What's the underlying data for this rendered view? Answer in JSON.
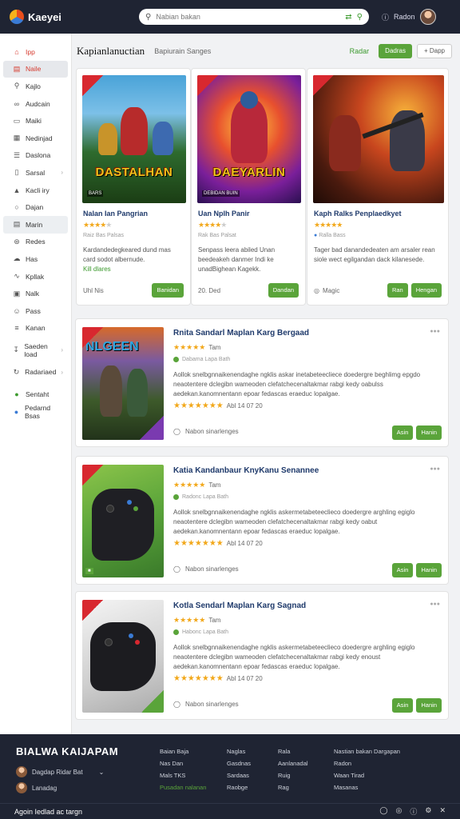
{
  "app": {
    "logo_text": "Kaeyei"
  },
  "search": {
    "placeholder": "Nabian bakan"
  },
  "topbar": {
    "user_label": "Radon"
  },
  "sidebar": {
    "items": [
      {
        "label": "Ipp",
        "icon": "home-icon"
      },
      {
        "label": "Naile",
        "icon": "store-icon"
      },
      {
        "label": "Kajlo",
        "icon": "search-icon"
      },
      {
        "label": "Audcain",
        "icon": "link-icon"
      },
      {
        "label": "Maiki",
        "icon": "monitor-icon"
      },
      {
        "label": "Nedinjad",
        "icon": "grid-icon"
      },
      {
        "label": "Daslona",
        "icon": "list-icon"
      },
      {
        "label": "Sarsal",
        "icon": "doc-icon"
      },
      {
        "label": "Kacli iry",
        "icon": "chart-icon"
      },
      {
        "label": "Dajan",
        "icon": "tag-icon"
      },
      {
        "label": "Marin",
        "icon": "layers-icon"
      },
      {
        "label": "Redes",
        "icon": "cart-icon"
      },
      {
        "label": "Has",
        "icon": "cloud-icon"
      },
      {
        "label": "Kpllak",
        "icon": "pulse-icon"
      },
      {
        "label": "Nalk",
        "icon": "image-icon"
      },
      {
        "label": "Pass",
        "icon": "user-icon"
      },
      {
        "label": "Kanan",
        "icon": "menu-icon"
      },
      {
        "label": "Saeden load",
        "icon": "download-icon"
      },
      {
        "label": "Radariaed",
        "icon": "refresh-icon"
      },
      {
        "label": "Sentaht",
        "icon": "globe-icon"
      },
      {
        "label": "Pedarnd Bsas",
        "icon": "globe-icon"
      }
    ]
  },
  "main": {
    "title": "Kapianlanuctian",
    "subtitle": "Bapiurain Sanges",
    "link_label": "Radar",
    "primary_button": "Dadras",
    "secondary_button": "Dapp"
  },
  "grid_cards": [
    {
      "cover_title": "DASTALHAN",
      "cover_sub": "BARS",
      "title": "Nalan Ian Pangrian",
      "rating": 4,
      "meta": "Raiz Bas Palsas",
      "desc": "Kardandedegkeared dund mas card sodot albernude.",
      "link": "Kill dlares",
      "footer_left": "Uhl Nis",
      "button": "Banidan"
    },
    {
      "cover_title": "DAEYARLIN",
      "cover_sub": "DEBIDAN BUIN",
      "title": "Uan Nplh Panir",
      "rating": 4,
      "meta": "Rak Bas Palsat",
      "desc": "Senpass leera abiled Unan beedeakeh danmer Indi ke unadBighean Kagekk.",
      "footer_left": "20. Ded",
      "button": "Dandan"
    },
    {
      "cover_title": "",
      "cover_sub": "",
      "title": "Kaph Ralks Penplaedkyet",
      "rating": 5,
      "meta": "Ralla Bass",
      "desc": "Tager bad danandedeaten am arsaler rean siole wect egilgandan dack kilanesede.",
      "footer_left": "Magic",
      "button1": "Ran",
      "button2": "Hengan"
    }
  ],
  "list_cards": [
    {
      "cover_title": "NLGEEN",
      "title": "Rnita Sandarl Maplan Karg Bergaad",
      "rating_text": "Tam",
      "meta": "Dabama Lapa Bath",
      "desc": "Aollok snelbgnnaikenendaghe ngklis askar inetabeteecliece doedergre beghlimg epgdo neaotentere dclegibn wameoden clefatchecenaltakmar rabgi kedy oabulss aedekan.kanomnentann epoar fedascas eraeduc lopalgae.",
      "score_text": "Abl 14 07 20",
      "footer": "Nabon sinarlenges",
      "btn1": "Asin",
      "btn2": "Hanin"
    },
    {
      "cover_title": "",
      "title": "Katia Kandanbaur KnyKanu Senannee",
      "rating_text": "Tam",
      "meta": "Radonc Lapa Bath",
      "desc": "Aollok snelbgnnaikenendaghe ngklis askermetabeteeclieco doedergre arghling egiglo neaotentere dclegibn wameoden clefatchecenaltakmar rabgi kedy oabut aedekan.kanomnentann epoar fedascas eraeduc lopalgae.",
      "score_text": "Abl 14 07 20",
      "footer": "Nabon sinarlenges",
      "btn1": "Asin",
      "btn2": "Hanin"
    },
    {
      "cover_title": "",
      "title": "Kotla Sendarl Maplan Karg Sagnad",
      "rating_text": "Tam",
      "meta": "Habonc Lapa Bath",
      "desc": "Aollok snelbgnnaikenendaghe ngklis askermetabeteeclieco doedergre arghling egiglo neaotentere dclegibn wameoden clefatchecenaltakmar rabgi kedy enoust aedekan.kanomnentann epoar fedascas eraeduc lopalgae.",
      "score_text": "Abl 14 07 20",
      "footer": "Nabon sinarlenges",
      "btn1": "Asin",
      "btn2": "Hanin"
    }
  ],
  "footer": {
    "brand": "BIALWA KAIJAPAM",
    "user1": "Dagdap Ridar Bat",
    "user2": "Lanadag",
    "col1": [
      "Baian Baja",
      "Nas Dan",
      "Mals TKS",
      "Pusadan nalanan"
    ],
    "col2": [
      "Naglas",
      "Gasdnas",
      "Sardaas",
      "Raobge"
    ],
    "col3": [
      "Rala",
      "Aanlanadal",
      "Ruig",
      "Rag"
    ],
    "col4": [
      "Nastian bakan Dargapan",
      "Radon",
      "Waan Tirad",
      "Masanas"
    ],
    "bottom_text": "Agoin Iedlad ac targn"
  }
}
